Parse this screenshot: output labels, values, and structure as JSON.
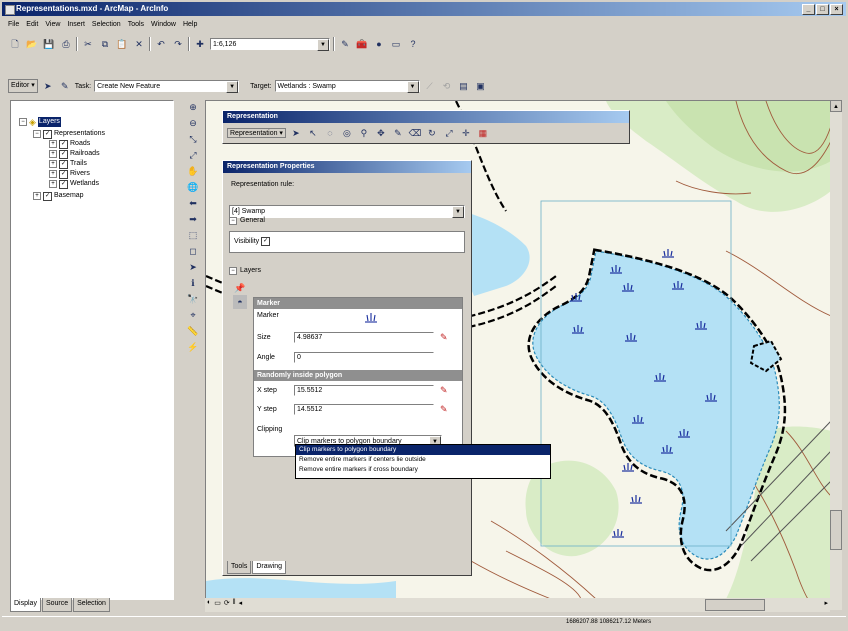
{
  "window": {
    "title": "Representations.mxd - ArcMap - ArcInfo",
    "buttons": [
      "_",
      "□",
      "×"
    ]
  },
  "menubar": [
    "File",
    "Edit",
    "View",
    "Insert",
    "Selection",
    "Tools",
    "Window",
    "Help"
  ],
  "standard_toolbar": {
    "scale_value": "1:6,126"
  },
  "editor_toolbar": {
    "editor_label": "Editor ▾",
    "task_label": "Task:",
    "task_value": "Create New Feature",
    "target_label": "Target:",
    "target_value": "Wetlands : Swamp"
  },
  "toc": {
    "items": [
      {
        "label": "Layers",
        "level": 0
      },
      {
        "label": "Representations",
        "level": 1
      },
      {
        "label": "Roads",
        "level": 2
      },
      {
        "label": "Railroads",
        "level": 2
      },
      {
        "label": "Trails",
        "level": 2
      },
      {
        "label": "Rivers",
        "level": 2
      },
      {
        "label": "Wetlands",
        "level": 2
      },
      {
        "label": "Basemap",
        "level": 1
      }
    ],
    "tabs": [
      "Display",
      "Source",
      "Selection"
    ]
  },
  "representation_toolbar": {
    "title": "Representation",
    "menu_label": "Representation ▾"
  },
  "properties": {
    "title": "Representation Properties",
    "rep_rule_label": "Representation rule:",
    "rep_rule_value": "[4] Swamp",
    "general_label": "General",
    "visibility_label": "Visibility",
    "layers_label": "Layers",
    "marker_header": "Marker",
    "marker_label": "Marker",
    "size_label": "Size",
    "size_value": "4.98637",
    "angle_label": "Angle",
    "angle_value": "0",
    "random_header": "Randomly inside polygon",
    "xstep_label": "X step",
    "xstep_value": "15.5512",
    "ystep_label": "Y step",
    "ystep_value": "14.5512",
    "clipping_label": "Clipping",
    "clipping_value": "Clip markers to polygon boundary",
    "tabs": [
      "Tools",
      "Drawing"
    ]
  },
  "dropdown": {
    "options": [
      "Clip markers to polygon boundary",
      "Remove entire markers if centers lie outside",
      "Remove entire markers if cross boundary"
    ],
    "selected_index": 0
  },
  "status": {
    "coordinates": "1686207.88  1086217.12 Meters"
  },
  "colors": {
    "swamp_fill": "#b4e1f5",
    "hatch_green": "#3cb45a",
    "marker_blue": "#1a2f9e",
    "contour": "#a05a3c",
    "vegetation": "#d9ecc6",
    "titlebar": "#0a246a"
  }
}
